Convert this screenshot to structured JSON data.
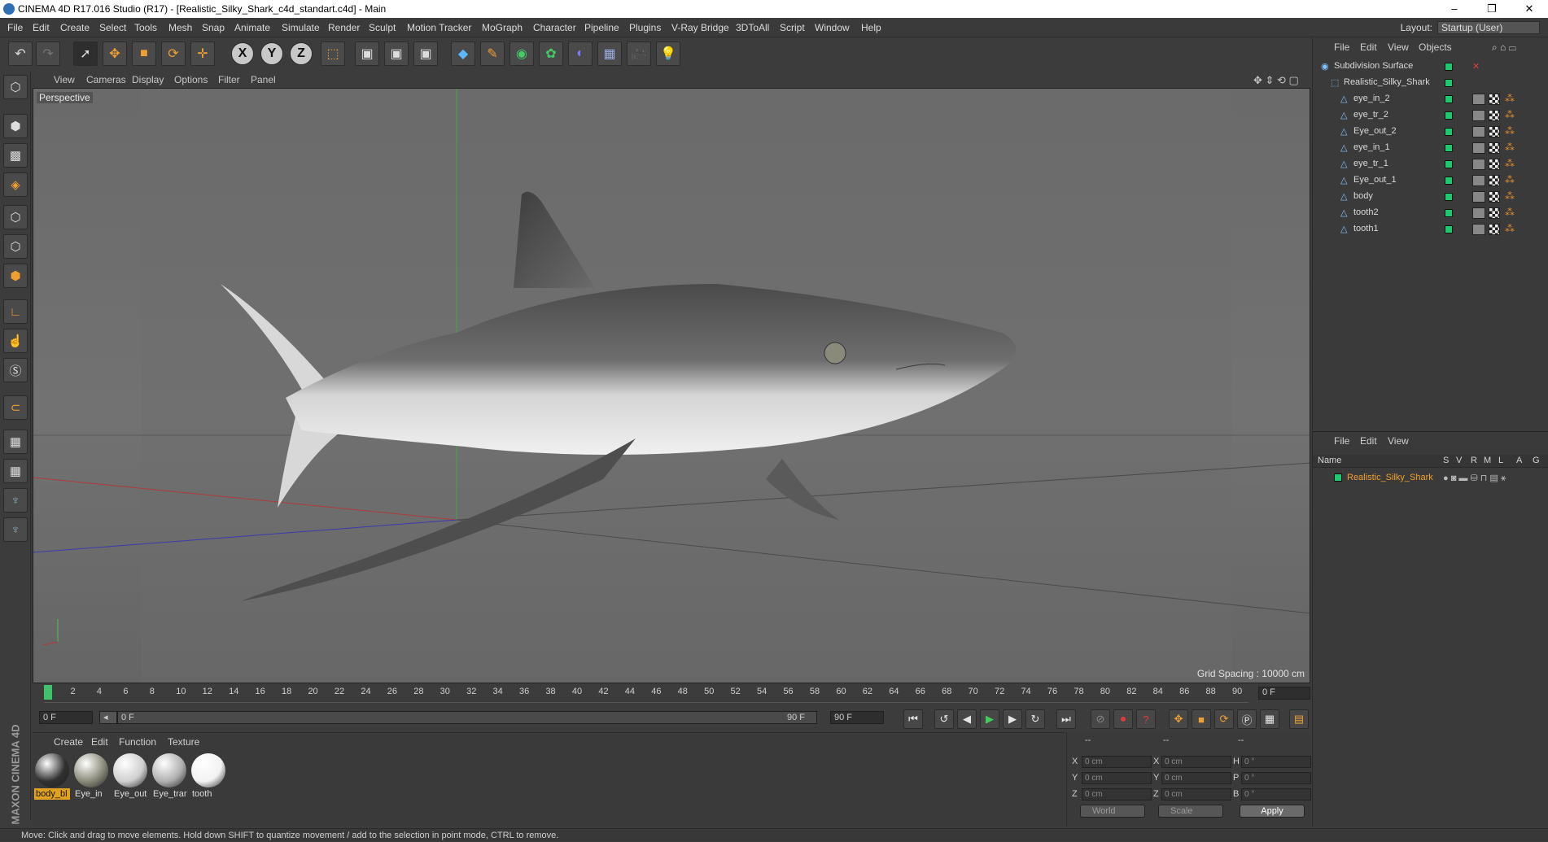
{
  "window": {
    "title": "CINEMA 4D R17.016 Studio (R17) - [Realistic_Silky_Shark_c4d_standart.c4d] - Main",
    "minimize": "–",
    "restore": "❐",
    "close": "✕"
  },
  "menubar": {
    "items": [
      "File",
      "Edit",
      "Create",
      "Select",
      "Tools",
      "Mesh",
      "Snap",
      "Animate",
      "Simulate",
      "Render",
      "Sculpt",
      "Motion Tracker",
      "MoGraph",
      "Character",
      "Pipeline",
      "Plugins",
      "V-Ray Bridge",
      "3DToAll",
      "Script",
      "Window",
      "Help"
    ],
    "layout_label": "Layout:",
    "layout_value": "Startup (User)"
  },
  "toolbar": {
    "axis_x": "X",
    "axis_y": "Y",
    "axis_z": "Z"
  },
  "viewport": {
    "menu": [
      "View",
      "Cameras",
      "Display",
      "Options",
      "Filter",
      "Panel"
    ],
    "label": "Perspective",
    "grid_spacing": "Grid Spacing : 10000 cm"
  },
  "timeline": {
    "ticks": [
      "0",
      "2",
      "4",
      "6",
      "8",
      "10",
      "12",
      "14",
      "16",
      "18",
      "20",
      "22",
      "24",
      "26",
      "28",
      "30",
      "32",
      "34",
      "36",
      "38",
      "40",
      "42",
      "44",
      "46",
      "48",
      "50",
      "52",
      "54",
      "56",
      "58",
      "60",
      "62",
      "64",
      "66",
      "68",
      "70",
      "72",
      "74",
      "76",
      "78",
      "80",
      "82",
      "84",
      "86",
      "88",
      "90"
    ],
    "end_frame_field": "0 F",
    "current_frame": "0 F",
    "range_start": "0 F",
    "range_end": "90 F",
    "max_frame": "90 F"
  },
  "material_manager": {
    "menu": [
      "Create",
      "Edit",
      "Function",
      "Texture"
    ],
    "materials": [
      {
        "name": "body_bl",
        "selected": true,
        "color": "#303030"
      },
      {
        "name": "Eye_in",
        "selected": false,
        "color": "#8a8a7a"
      },
      {
        "name": "Eye_out",
        "selected": false,
        "color": "#cfcfcf"
      },
      {
        "name": "Eye_trar",
        "selected": false,
        "color": "#b0b0b0"
      },
      {
        "name": "tooth",
        "selected": false,
        "color": "#f2f2f2"
      }
    ]
  },
  "coordinates": {
    "headers": [
      "--",
      "--",
      "--"
    ],
    "rows": [
      {
        "a": "X",
        "av": "0 cm",
        "b": "X",
        "bv": "0 cm",
        "c": "H",
        "cv": "0 °"
      },
      {
        "a": "Y",
        "av": "0 cm",
        "b": "Y",
        "bv": "0 cm",
        "c": "P",
        "cv": "0 °"
      },
      {
        "a": "Z",
        "av": "0 cm",
        "b": "Z",
        "bv": "0 cm",
        "c": "B",
        "cv": "0 °"
      }
    ],
    "world": "World",
    "scale": "Scale",
    "apply": "Apply"
  },
  "object_manager": {
    "menu": [
      "File",
      "Edit",
      "View",
      "Objects"
    ],
    "objects": [
      {
        "name": "Subdivision Surface",
        "indent": 0
      },
      {
        "name": "Realistic_Silky_Shark",
        "indent": 1
      },
      {
        "name": "eye_in_2",
        "indent": 2
      },
      {
        "name": "eye_tr_2",
        "indent": 2
      },
      {
        "name": "Eye_out_2",
        "indent": 2
      },
      {
        "name": "eye_in_1",
        "indent": 2
      },
      {
        "name": "eye_tr_1",
        "indent": 2
      },
      {
        "name": "Eye_out_1",
        "indent": 2
      },
      {
        "name": "body",
        "indent": 2
      },
      {
        "name": "tooth2",
        "indent": 2
      },
      {
        "name": "tooth1",
        "indent": 2
      }
    ]
  },
  "attribute_manager": {
    "menu": [
      "File",
      "Edit",
      "View"
    ],
    "columns": [
      "Name",
      "S",
      "V",
      "R",
      "M",
      "L",
      "A",
      "G"
    ],
    "selected_object": "Realistic_Silky_Shark"
  },
  "status": "Move: Click and drag to move elements. Hold down SHIFT to quantize movement / add to the selection in point mode, CTRL to remove.",
  "brand": "MAXON CINEMA 4D"
}
